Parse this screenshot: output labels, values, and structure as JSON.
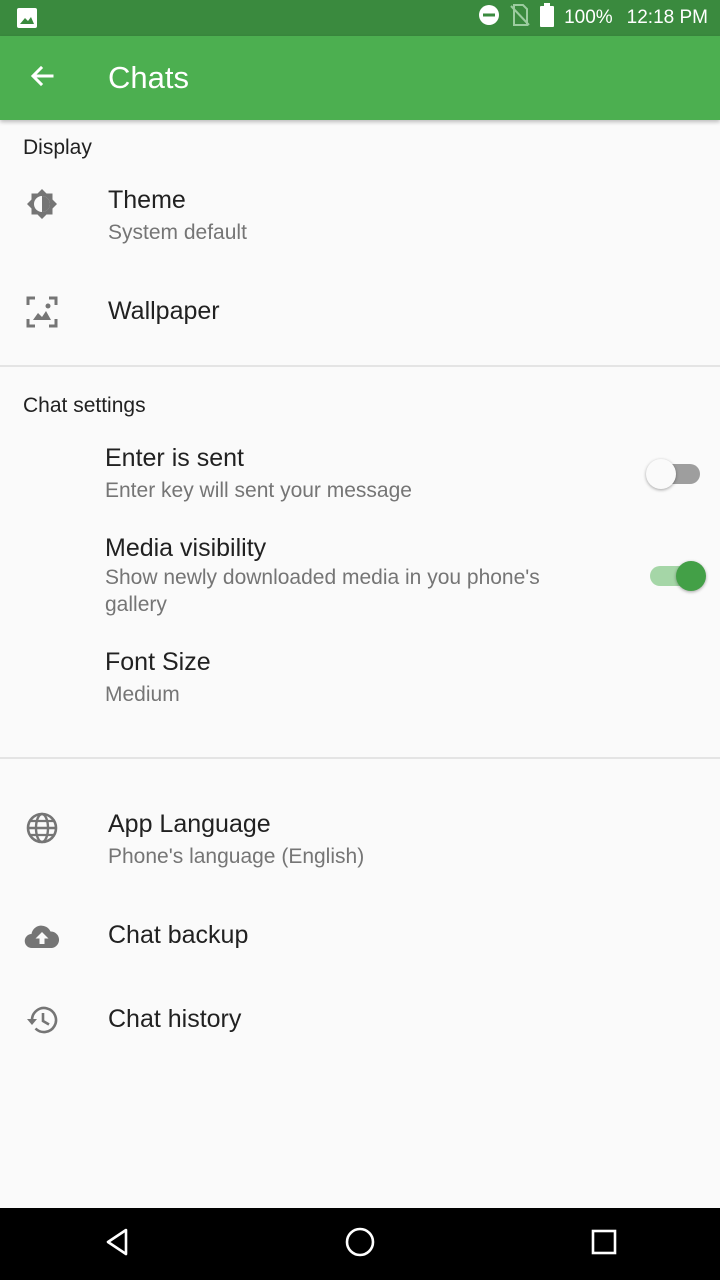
{
  "status_bar": {
    "battery": "100%",
    "time": "12:18 PM",
    "icons": [
      "image-icon",
      "do-not-disturb-icon",
      "no-sim-icon",
      "battery-icon"
    ]
  },
  "app_bar": {
    "title": "Chats",
    "back_icon": "arrow-back-icon",
    "background": "#4caf50",
    "status_background": "#3a8a3e"
  },
  "display": {
    "header": "Display",
    "theme": {
      "title": "Theme",
      "subtitle": "System default",
      "icon": "brightness-icon"
    },
    "wallpaper": {
      "title": "Wallpaper",
      "icon": "wallpaper-icon"
    }
  },
  "chat_settings": {
    "header": "Chat settings",
    "enter_is_sent": {
      "title": "Enter is sent",
      "subtitle": "Enter key will sent your message",
      "enabled": false
    },
    "media_visibility": {
      "title": "Media visibility",
      "subtitle": "Show newly downloaded media in you phone's gallery",
      "enabled": true
    },
    "font_size": {
      "title": "Font Size",
      "subtitle": "Medium"
    }
  },
  "other": {
    "app_language": {
      "title": "App Language",
      "subtitle": "Phone's language (English)",
      "icon": "globe-icon"
    },
    "chat_backup": {
      "title": "Chat backup",
      "icon": "cloud-upload-icon"
    },
    "chat_history": {
      "title": "Chat history",
      "icon": "history-icon"
    }
  },
  "nav_bar": {
    "icons": [
      "back-triangle-icon",
      "home-circle-icon",
      "recents-square-icon"
    ]
  },
  "colors": {
    "accent": "#43a047",
    "text_primary": "#212121",
    "text_secondary": "#757575"
  }
}
